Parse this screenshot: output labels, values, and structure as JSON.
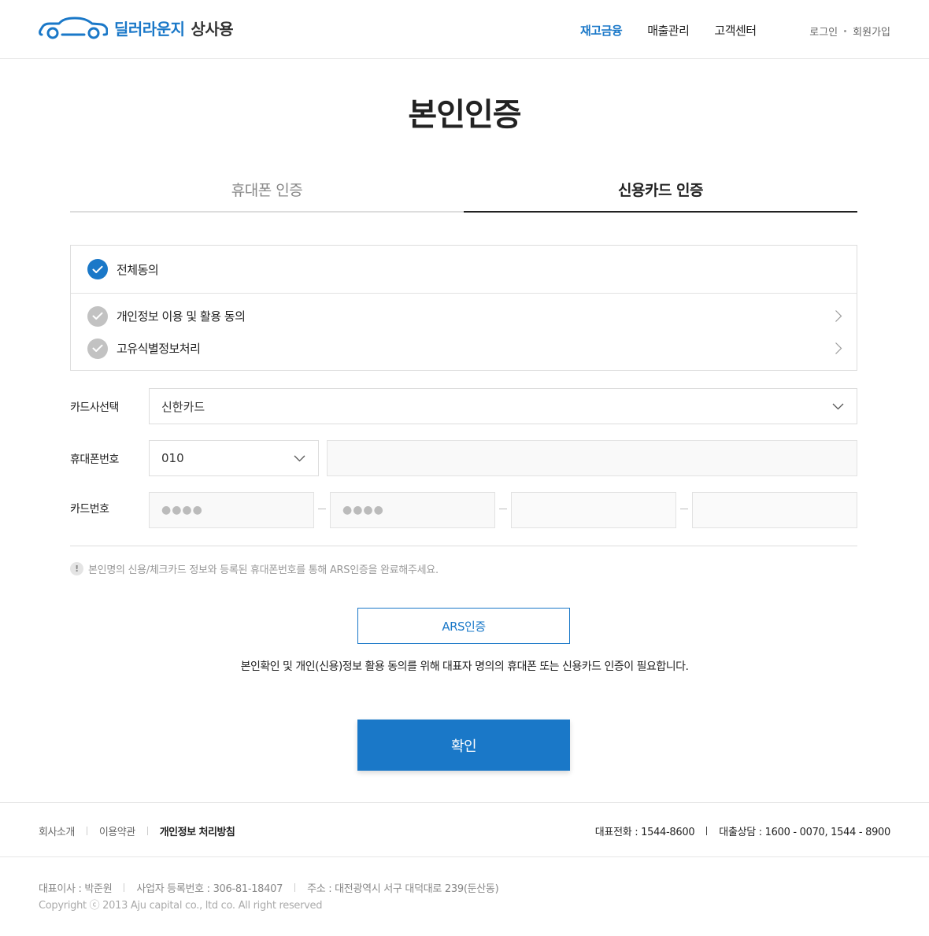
{
  "header": {
    "brand": "딜러라운지",
    "brand_sub": "상사용",
    "nav": [
      {
        "label": "재고금융",
        "active": true
      },
      {
        "label": "매출관리",
        "active": false
      },
      {
        "label": "고객센터",
        "active": false
      }
    ],
    "login": "로그인",
    "signup": "회원가입"
  },
  "title": "본인인증",
  "tabs": [
    {
      "label": "휴대폰 인증",
      "active": false
    },
    {
      "label": "신용카드 인증",
      "active": true
    }
  ],
  "agreements": {
    "all": {
      "label": "전체동의",
      "checked": true
    },
    "items": [
      {
        "label": "개인정보 이용 및 활용 동의",
        "checked": false
      },
      {
        "label": "고유식별정보처리",
        "checked": false
      }
    ]
  },
  "form": {
    "card_company_label": "카드사선택",
    "card_company_value": "신한카드",
    "phone_label": "휴대폰번호",
    "phone_prefix": "010",
    "phone_number": "",
    "card_number_label": "카드번호",
    "card_number_parts": [
      "●●●●",
      "●●●●",
      "",
      ""
    ]
  },
  "notice": "본인명의 신용/체크카드 정보와 등록된 휴대폰번호를 통해 ARS인증을 완료해주세요.",
  "ars_button": "ARS인증",
  "description": "본인확인 및 개인(신용)정보 활용 동의를 위해 대표자 명의의 휴대폰 또는 신용카드 인증이 필요합니다.",
  "confirm_button": "확인",
  "footer": {
    "links": [
      "회사소개",
      "이용약관",
      "개인정보 처리방침"
    ],
    "phone_main": "대표전화 : 1544-8600",
    "phone_loan": "대출상담 : 1600 - 0070, 1544 - 8900",
    "ceo": "대표이사 : 박준원",
    "biz_no": "사업자 등록번호 : 306-81-18407",
    "address": "주소 : 대전광역시 서구 대덕대로 239(둔산동)",
    "copyright": "Copyright ⓒ 2013 Aju capital co., ltd co. All right reserved"
  },
  "colors": {
    "accent": "#1a78c8",
    "unchecked": "#c2c2c2"
  }
}
